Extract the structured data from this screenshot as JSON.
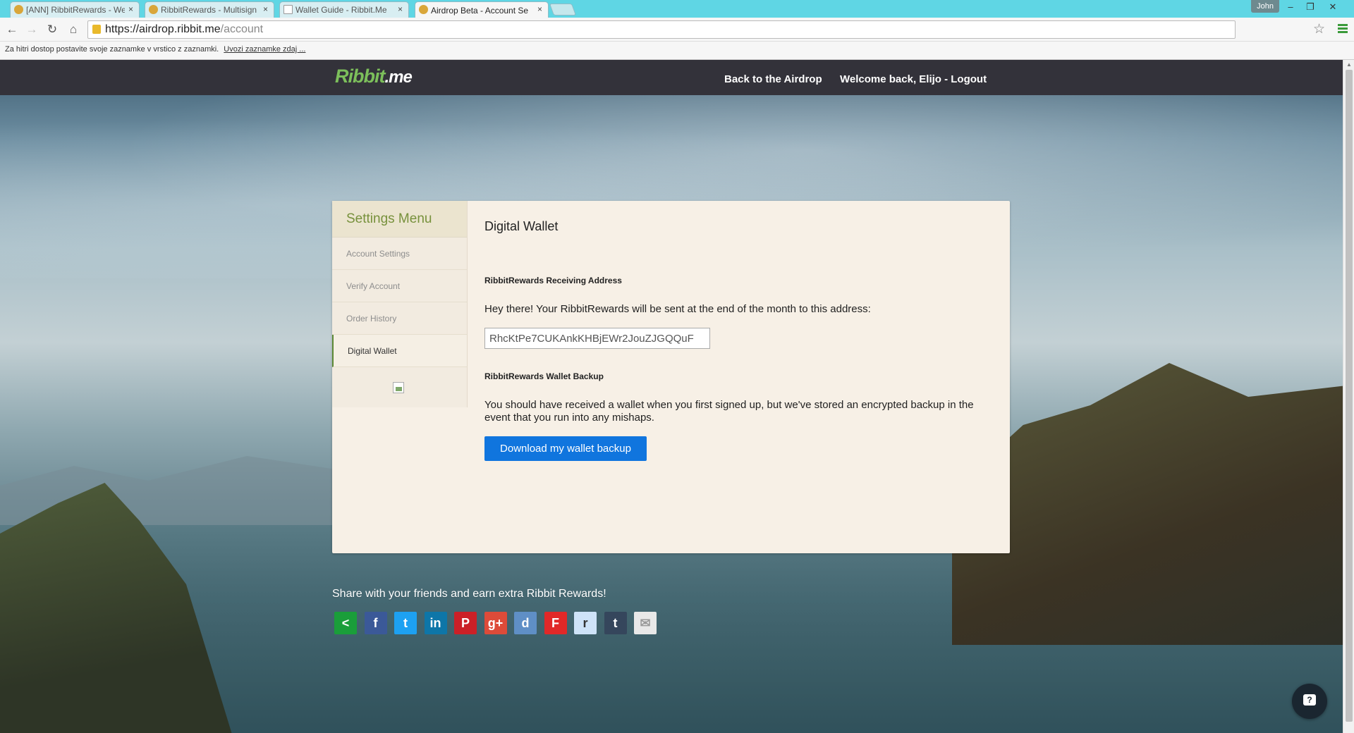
{
  "browser": {
    "tabs": [
      {
        "label": "[ANN] RibbitRewards - We",
        "close": "×",
        "active": false
      },
      {
        "label": "RibbitRewards - Multisign",
        "close": "×",
        "active": false
      },
      {
        "label": "Wallet Guide - Ribbit.Me",
        "close": "×",
        "active": false
      },
      {
        "label": "Airdrop Beta - Account Se",
        "close": "×",
        "active": true
      }
    ],
    "user": "John",
    "url_host": "https://airdrop.ribbit.me",
    "url_path": "/account",
    "bookmarks_text": "Za hitri dostop postavite svoje zaznamke v vrstico z zaznamki.",
    "bookmarks_link": "Uvozi zaznamke zdaj ..."
  },
  "site": {
    "logo_main": "Ribbit",
    "logo_suffix": ".me",
    "nav_back": "Back to the Airdrop",
    "nav_welcome": "Welcome back, Elijo - Logout"
  },
  "sidebar": {
    "title": "Settings Menu",
    "items": [
      {
        "label": "Account Settings"
      },
      {
        "label": "Verify Account"
      },
      {
        "label": "Order History"
      },
      {
        "label": "Digital Wallet"
      }
    ]
  },
  "content": {
    "title": "Digital Wallet",
    "receiving_heading": "RibbitRewards Receiving Address",
    "receiving_text": "Hey there! Your RibbitRewards will be sent at the end of the month to this address:",
    "address_value": "RhcKtPe7CUKAnkKHBjEWr2JouZJGQQuF",
    "backup_heading": "RibbitRewards Wallet Backup",
    "backup_text": "You should have received a wallet when you first signed up, but we've stored an encrypted backup in the event that you run into any mishaps.",
    "download_button": "Download my wallet backup"
  },
  "share": {
    "text": "Share with your friends and earn extra Ribbit Rewards!",
    "buttons": [
      {
        "icon": "share-icon",
        "glyph": "<",
        "color": "#1a9e3a"
      },
      {
        "icon": "facebook-icon",
        "glyph": "f",
        "color": "#3b5998"
      },
      {
        "icon": "twitter-icon",
        "glyph": "t",
        "color": "#1da1f2"
      },
      {
        "icon": "linkedin-icon",
        "glyph": "in",
        "color": "#0e76a8"
      },
      {
        "icon": "pinterest-icon",
        "glyph": "P",
        "color": "#cb2027"
      },
      {
        "icon": "google-plus-icon",
        "glyph": "g+",
        "color": "#dd4b39"
      },
      {
        "icon": "delicious-icon",
        "glyph": "d",
        "color": "#5f8fc6"
      },
      {
        "icon": "flipboard-icon",
        "glyph": "F",
        "color": "#e12828"
      },
      {
        "icon": "reddit-icon",
        "glyph": "r",
        "color": "#cee3f8"
      },
      {
        "icon": "tumblr-icon",
        "glyph": "t",
        "color": "#35465c"
      },
      {
        "icon": "email-icon",
        "glyph": "✉",
        "color": "#e8e8e8"
      }
    ]
  }
}
